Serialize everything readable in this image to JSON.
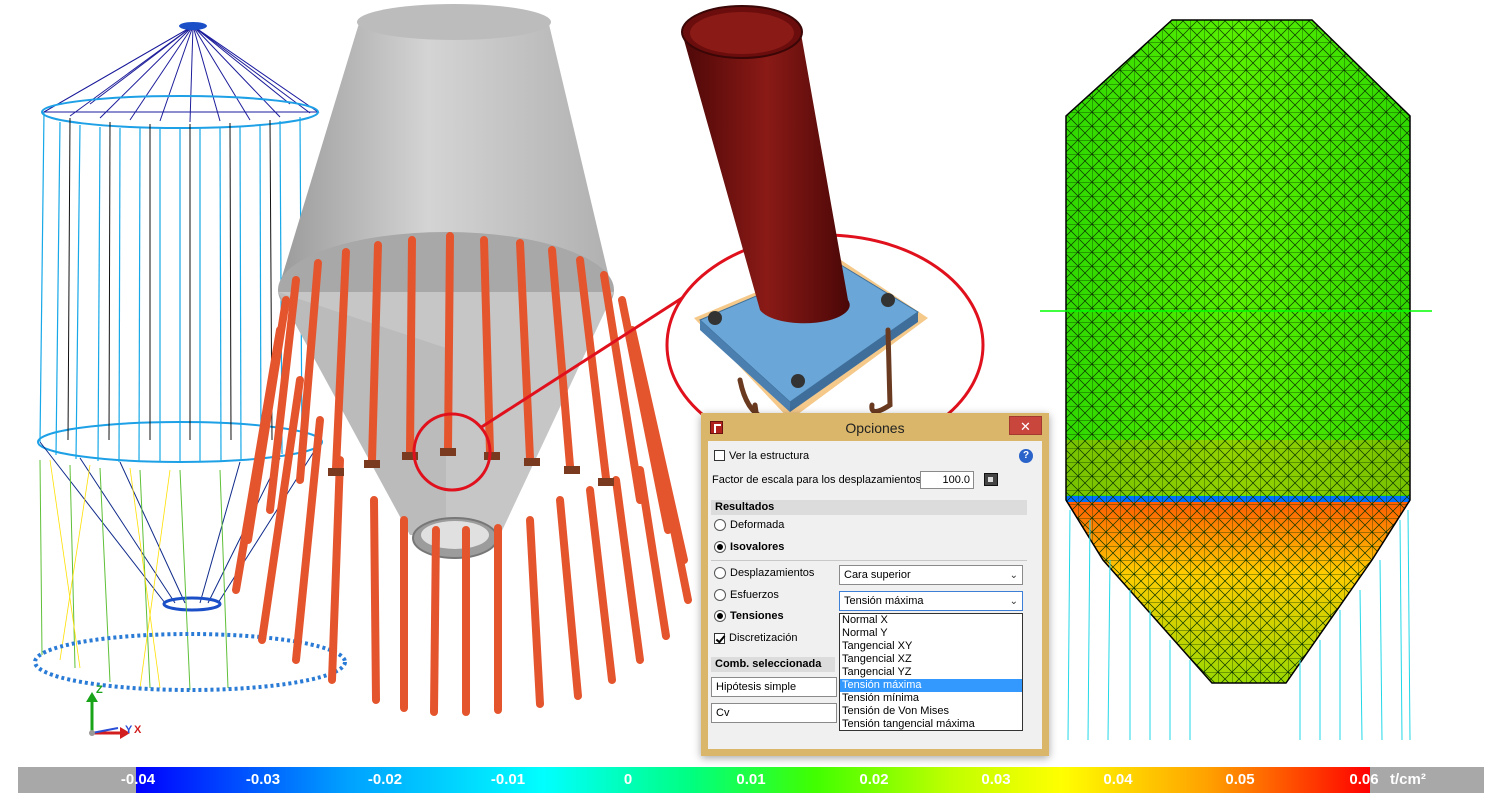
{
  "dialog": {
    "title": "Opciones",
    "close_glyph": "✕",
    "show_structure_label": "Ver la estructura",
    "scale_factor_label": "Factor de escala para los desplazamientos",
    "scale_factor_value": "100.0",
    "results_section": "Resultados",
    "radio_deformada": "Deformada",
    "radio_isovalores": "Isovalores",
    "radio_desplazamientos": "Desplazamientos",
    "radio_esfuerzos": "Esfuerzos",
    "radio_tensiones": "Tensiones",
    "discretizacion_label": "Discretización",
    "face_combo_value": "Cara superior",
    "stress_combo_value": "Tensión máxima",
    "combo_section": "Comb. seleccionada",
    "hypothesis_combo_value": "Hipótesis simple",
    "load_combo_value": "Cv",
    "stress_options": [
      "Normal X",
      "Normal Y",
      "Tangencial XY",
      "Tangencial XZ",
      "Tangencial YZ",
      "Tensión máxima",
      "Tensión mínima",
      "Tensión de Von Mises",
      "Tensión tangencial máxima"
    ],
    "selected_option_index": 5
  },
  "legend": {
    "ticks": [
      "-0.04",
      "-0.03",
      "-0.02",
      "-0.01",
      "0",
      "0.01",
      "0.02",
      "0.03",
      "0.04",
      "0.05",
      "0.06"
    ],
    "unit": "t/cm²",
    "colors": [
      "#0000ff",
      "#00ffff",
      "#00ff00",
      "#ffff00",
      "#ff0000"
    ]
  },
  "axes": {
    "z": "Z",
    "y": "Y",
    "x": "X"
  },
  "colors": {
    "dialog_frame": "#d9b66a",
    "close_button": "#c9463d",
    "selection": "#3399ff",
    "steel_column": "#e4552e",
    "silo_shell": "#c8c8c8",
    "pipe": "#6b0d0d",
    "base_plate": "#6aa6d8"
  }
}
